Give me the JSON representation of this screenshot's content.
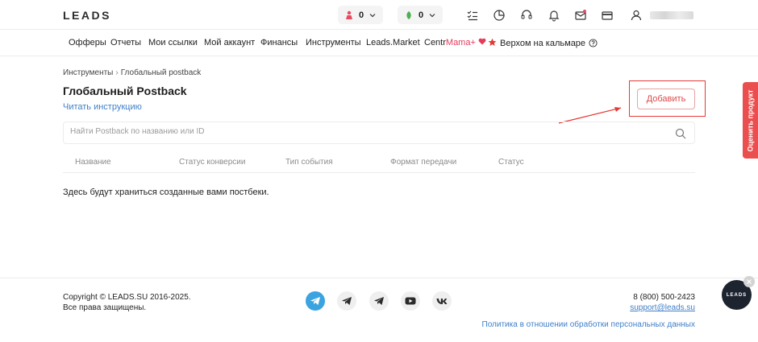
{
  "header": {
    "logo": "LEADS",
    "counter_left": {
      "value": "0",
      "icon": "person-rank-icon",
      "color": "#e84a5f"
    },
    "counter_right": {
      "value": "0",
      "icon": "leaf-icon",
      "color": "#4caf50"
    },
    "icons": [
      "tasks-icon",
      "stats-globe-icon",
      "headset-icon",
      "bell-icon",
      "mail-icon",
      "card-icon",
      "user-icon"
    ]
  },
  "menu": {
    "items": [
      "Офферы",
      "Отчеты",
      "Мои ссылки",
      "Мой аккаунт",
      "Финансы",
      "Инструменты",
      "Leads.Market"
    ],
    "centr_prefix": "Centr",
    "centr_suffix": "Mama+",
    "promo": "Верхом на кальмаре",
    "help_icon": "question-icon"
  },
  "breadcrumb": {
    "parent": "Инструменты",
    "separator": "›",
    "current": "Глобальный postback"
  },
  "page": {
    "title": "Глобальный Postback",
    "instruction_link": "Читать инструкцию",
    "add_button": "Добавить",
    "search_placeholder": "Найти Postback по названию или ID",
    "columns": [
      "Название",
      "Статус конверсии",
      "Тип события",
      "Формат передачи",
      "Статус"
    ],
    "empty_message": "Здесь будут храниться созданные вами постбеки."
  },
  "feedback_tab": "Оценить продукт",
  "footer": {
    "copyright": "Copyright © LEADS.SU 2016-2025.",
    "rights": "Все права защищены.",
    "phone": "8 (800) 500-2423",
    "email": "support@leads.su",
    "policy": "Политика в отношении обработки персональных данных",
    "socials": [
      "telegram-news-icon",
      "telegram-chat-icon",
      "telegram-channel-icon",
      "youtube-icon",
      "vk-icon"
    ]
  },
  "chat": {
    "label": "LEADS"
  },
  "colors": {
    "accent_red": "#e53935",
    "link_blue": "#3f7fc8",
    "pink": "#e53b5b"
  }
}
